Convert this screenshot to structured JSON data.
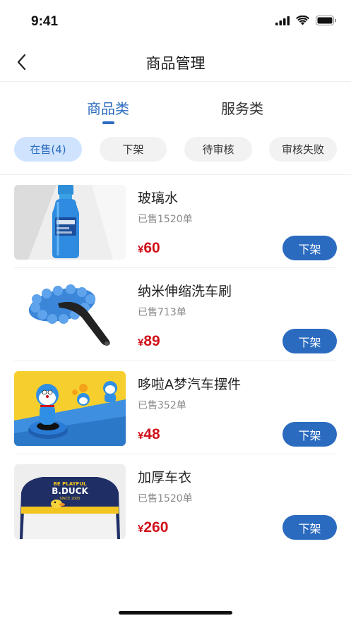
{
  "status_bar": {
    "time": "9:41",
    "icons": [
      "signal-icon",
      "wifi-icon",
      "battery-icon"
    ]
  },
  "nav": {
    "title": "商品管理",
    "back_icon": "chevron-left-icon"
  },
  "tabs": [
    {
      "label": "商品类",
      "active": true
    },
    {
      "label": "服务类",
      "active": false
    }
  ],
  "filters": [
    {
      "label": "在售(4)",
      "active": true
    },
    {
      "label": "下架",
      "active": false
    },
    {
      "label": "待审核",
      "active": false
    },
    {
      "label": "审核失败",
      "active": false
    }
  ],
  "products": [
    {
      "title": "玻璃水",
      "sold": "已售1520单",
      "currency": "¥",
      "price": "60",
      "action": "下架",
      "image": "washer-fluid-bottle"
    },
    {
      "title": "纳米伸缩洗车刷",
      "sold": "已售713单",
      "currency": "¥",
      "price": "89",
      "action": "下架",
      "image": "chenille-car-brush"
    },
    {
      "title": "哆啦A梦汽车摆件",
      "sold": "已售352单",
      "currency": "¥",
      "price": "48",
      "action": "下架",
      "image": "doraemon-car-ornament"
    },
    {
      "title": "加厚车衣",
      "sold": "已售1520单",
      "currency": "¥",
      "price": "260",
      "action": "下架",
      "image": "car-cover",
      "image_text": [
        "BE PLAYFUL",
        "B.DUCK",
        "SINCE 2005"
      ]
    }
  ],
  "colors": {
    "primary": "#2b6bbf",
    "chip_active_bg": "#cfe3ff",
    "price": "#d0121b"
  }
}
